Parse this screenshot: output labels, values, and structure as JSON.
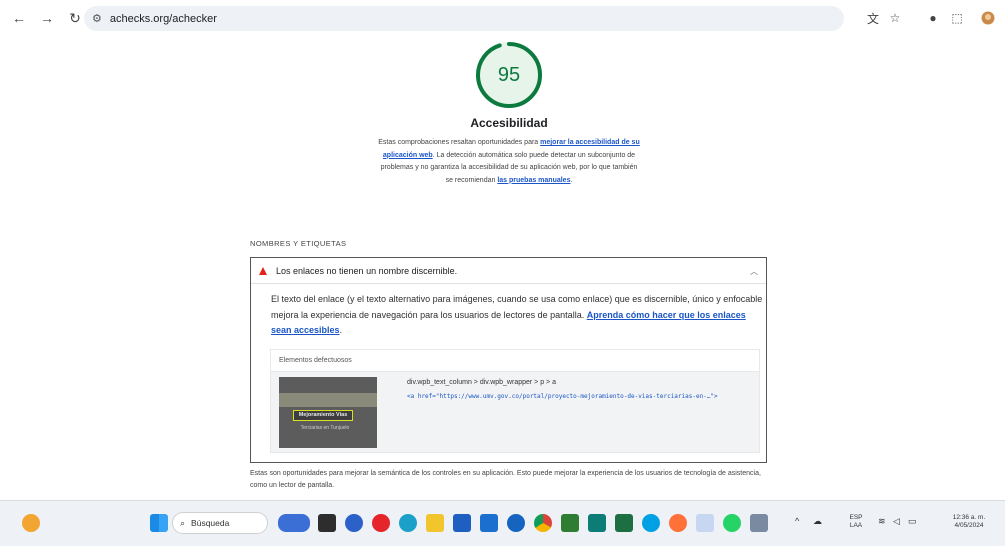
{
  "browser": {
    "url": "achecks.org/achecker",
    "icons": [
      "back-icon",
      "forward-icon",
      "reload-icon",
      "site-info-icon",
      "translate-icon",
      "bookmark-star-icon",
      "extension-icon",
      "profile-avatar"
    ]
  },
  "gauge": {
    "score": "95",
    "title": "Accesibilidad",
    "desc_part1": "Estas comprobaciones resaltan oportunidades para ",
    "desc_link1": "mejorar la accesibilidad de su aplicación web",
    "desc_part2": ". La detección automática solo puede detectar un subconjunto de problemas y no garantiza la accesibilidad de su aplicación web, por lo que también se recomiendan ",
    "desc_link2": "las pruebas manuales",
    "desc_part3": ".",
    "color": "#0c7a3e"
  },
  "section": {
    "group_title": "NOMBRES Y ETIQUETAS",
    "audit_title": "Los enlaces no tienen un nombre discernible.",
    "audit_desc": "El texto del enlace (y el texto alternativo para imágenes, cuando se usa como enlace) que es discernible, único y enfocable mejora la experiencia de navegación para los usuarios de lectores de pantalla. ",
    "audit_link": "Aprenda cómo hacer que los enlaces sean accesibles",
    "audit_desc_end": ".",
    "failing_header": "Elementos defectuosos",
    "node_path": "div.wpb_text_column > div.wpb_wrapper > p > a",
    "node_snippet": "<a href=\"https://www.umv.gov.co/portal/proyecto-mejoramiento-de-vias-terciarias-en-…\">",
    "thumb_text1": "Mejoramiento Vías",
    "thumb_text2": "Terciarias en Tunjuelo",
    "footer": "Estas son oportunidades para mejorar la semántica de los controles en su aplicación. Esto puede mejorar la experiencia de los usuarios de tecnología de asistencia, como un lector de pantalla."
  },
  "taskbar": {
    "search_placeholder": "Búsqueda",
    "lang_top": "ESP",
    "lang_bottom": "LAA",
    "time": "12:36 a. m.",
    "date": "4/05/2024"
  }
}
